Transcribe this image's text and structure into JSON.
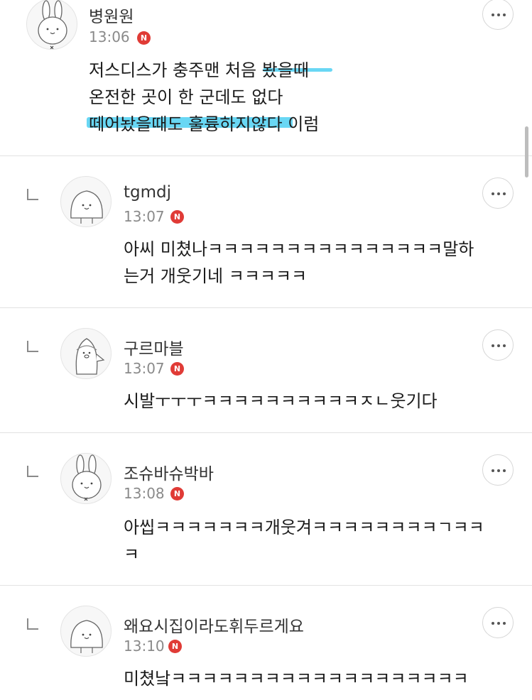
{
  "comments": [
    {
      "author": "병원원",
      "time": "13:06",
      "badge": "N",
      "lines": [
        "저스디스가 충주맨 처음 봤을때",
        "온전한 곳이 한 군데도 없다",
        "떼어놨을때도 훌륭하지않다 이럼"
      ]
    },
    {
      "author": "tgmdj",
      "time": "13:07",
      "badge": "N",
      "lines": [
        "아씨 미쳤나ㅋㅋㅋㅋㅋㅋㅋㅋㅋㅋㅋㅋㅋㅋㅋ말하",
        "는거 개웃기네 ㅋㅋㅋㅋㅋ"
      ]
    },
    {
      "author": "구르마블",
      "time": "13:07",
      "badge": "N",
      "lines": [
        "시발ㅜㅜㅜㅋㅋㅋㅋㅋㅋㅋㅋㅋㅋㅈㄴ웃기다"
      ]
    },
    {
      "author": "조슈바슈박바",
      "time": "13:08",
      "badge": "N",
      "lines": [
        "아씹ㅋㅋㅋㅋㅋㅋㅋ개웃겨ㅋㅋㅋㅋㅋㅋㅋㅋㄱㅋㅋ",
        "ㅋ"
      ]
    },
    {
      "author": "왜요시집이라도휘두르게요",
      "time": "13:10",
      "badge": "N",
      "lines": [
        "미쳤낰ㅋㅋㅋㅋㅋㅋㅋㅋㅋㅋㅋㅋㅋㅋㅋㅋㅋㅋㅋ"
      ]
    }
  ],
  "colors": {
    "highlight": "#4fd0f2",
    "badge": "#e03b36",
    "divider": "#e2e2e2"
  },
  "icons": {
    "more": "more-dots-icon",
    "reply": "reply-arrow-icon",
    "avatar_rabbit": "rabbit-avatar-icon",
    "avatar_blob": "blob-avatar-icon",
    "avatar_penguin": "penguin-avatar-icon"
  }
}
